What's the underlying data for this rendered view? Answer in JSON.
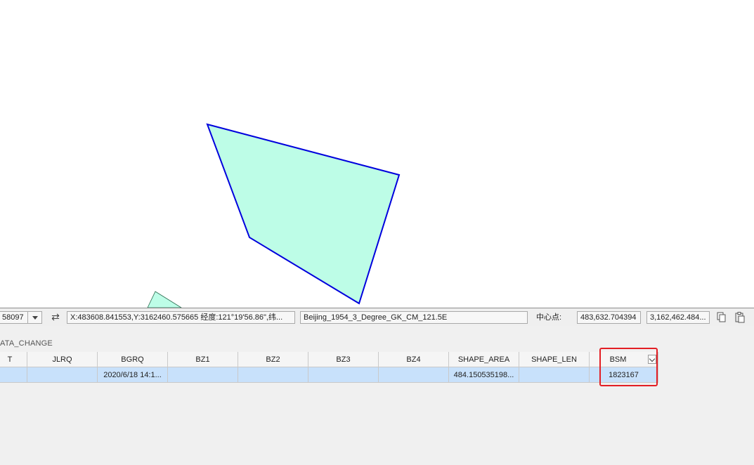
{
  "map": {
    "fill_color": "#bdfde7",
    "selected_outline_color": "#0000dd",
    "outline_color": "#2a6b4f"
  },
  "status_bar": {
    "scale_value": "58097",
    "coordinates": "X:483608.841553,Y:3162460.575665  经度:121°19'56.86\",纬...",
    "coordinate_system": "Beijing_1954_3_Degree_GK_CM_121.5E",
    "center_label": "中心点:",
    "center_x": "483,632.704394",
    "center_y": "3,162,462.484..."
  },
  "table": {
    "tab_title": "ATA_CHANGE",
    "columns": [
      "T",
      "JLRQ",
      "BGRQ",
      "BZ1",
      "BZ2",
      "BZ3",
      "BZ4",
      "SHAPE_AREA",
      "SHAPE_LEN",
      "BSM"
    ],
    "rows": [
      [
        "",
        "",
        "2020/6/18 14:1...",
        "",
        "",
        "",
        "",
        "484.150535198...",
        "",
        "1823167"
      ]
    ]
  },
  "colors": {
    "selected_row": "#c8e1fb",
    "highlight_box": "#e31e24"
  }
}
